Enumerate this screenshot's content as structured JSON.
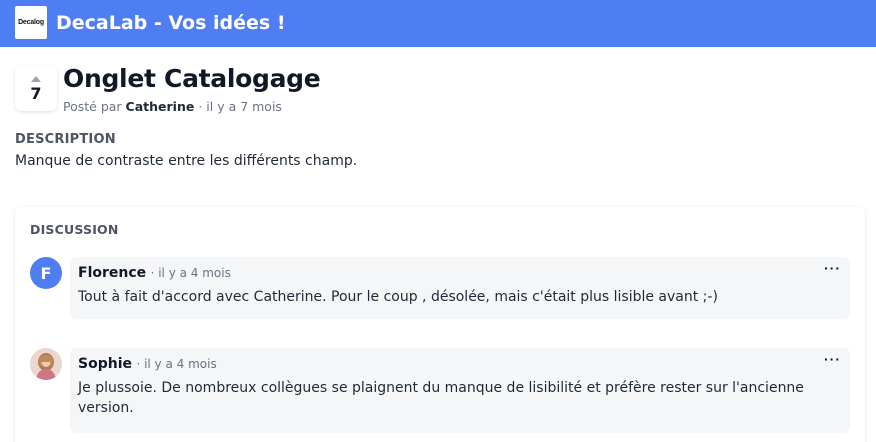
{
  "header": {
    "logo_text": "Decalog",
    "title": "DecaLab - Vos idées !",
    "bg_color": "#4f7df2"
  },
  "post": {
    "vote_count": "7",
    "title": "Onglet Catalogage",
    "meta_prefix": "Posté par",
    "author": "Catherine",
    "time": "· il y a 7 mois",
    "description_label": "DESCRIPTION",
    "description": "Manque de contraste entre les différents champ."
  },
  "discussion": {
    "label": "DISCUSSION",
    "comments": [
      {
        "avatar_letter": "F",
        "author": "Florence",
        "time": "· il y a 4 mois",
        "text": "Tout à fait d'accord avec Catherine. Pour le coup , désolée, mais c'était plus lisible avant ;-)",
        "menu": "···"
      },
      {
        "avatar_letter": "",
        "author": "Sophie",
        "time": "· il y a 4 mois",
        "text": "Je plussoie. De nombreux collègues se plaignent du manque de lisibilité et préfère rester sur l'ancienne version.",
        "menu": "···"
      }
    ]
  }
}
